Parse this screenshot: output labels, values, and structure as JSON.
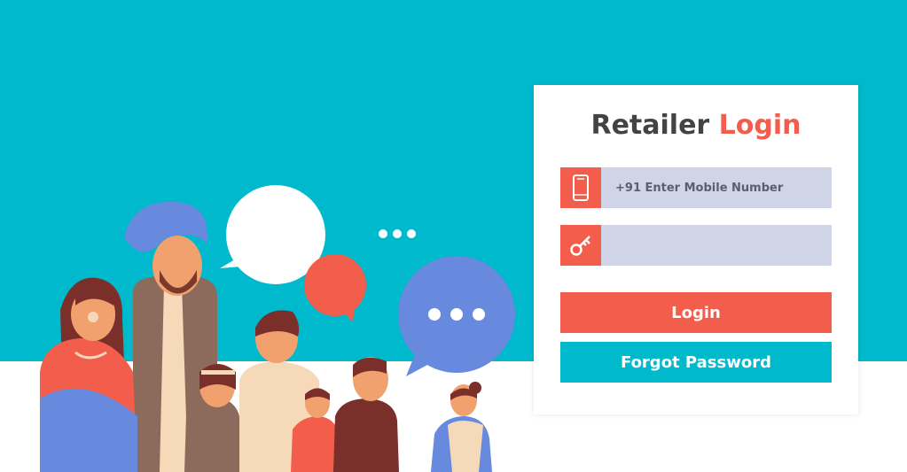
{
  "login_card": {
    "title_main": "Retailer",
    "title_accent": "Login",
    "mobile_placeholder": "+91 Enter Mobile Number",
    "password_placeholder": "",
    "login_label": "Login",
    "forgot_label": "Forgot Password"
  },
  "icons": {
    "mobile": "mobile-phone-icon",
    "key": "key-icon"
  },
  "colors": {
    "teal": "#00b9cc",
    "coral": "#f35d4b",
    "input_bg": "#cfd5e6",
    "title_dark": "#434343",
    "bubble_blue": "#6789de"
  }
}
